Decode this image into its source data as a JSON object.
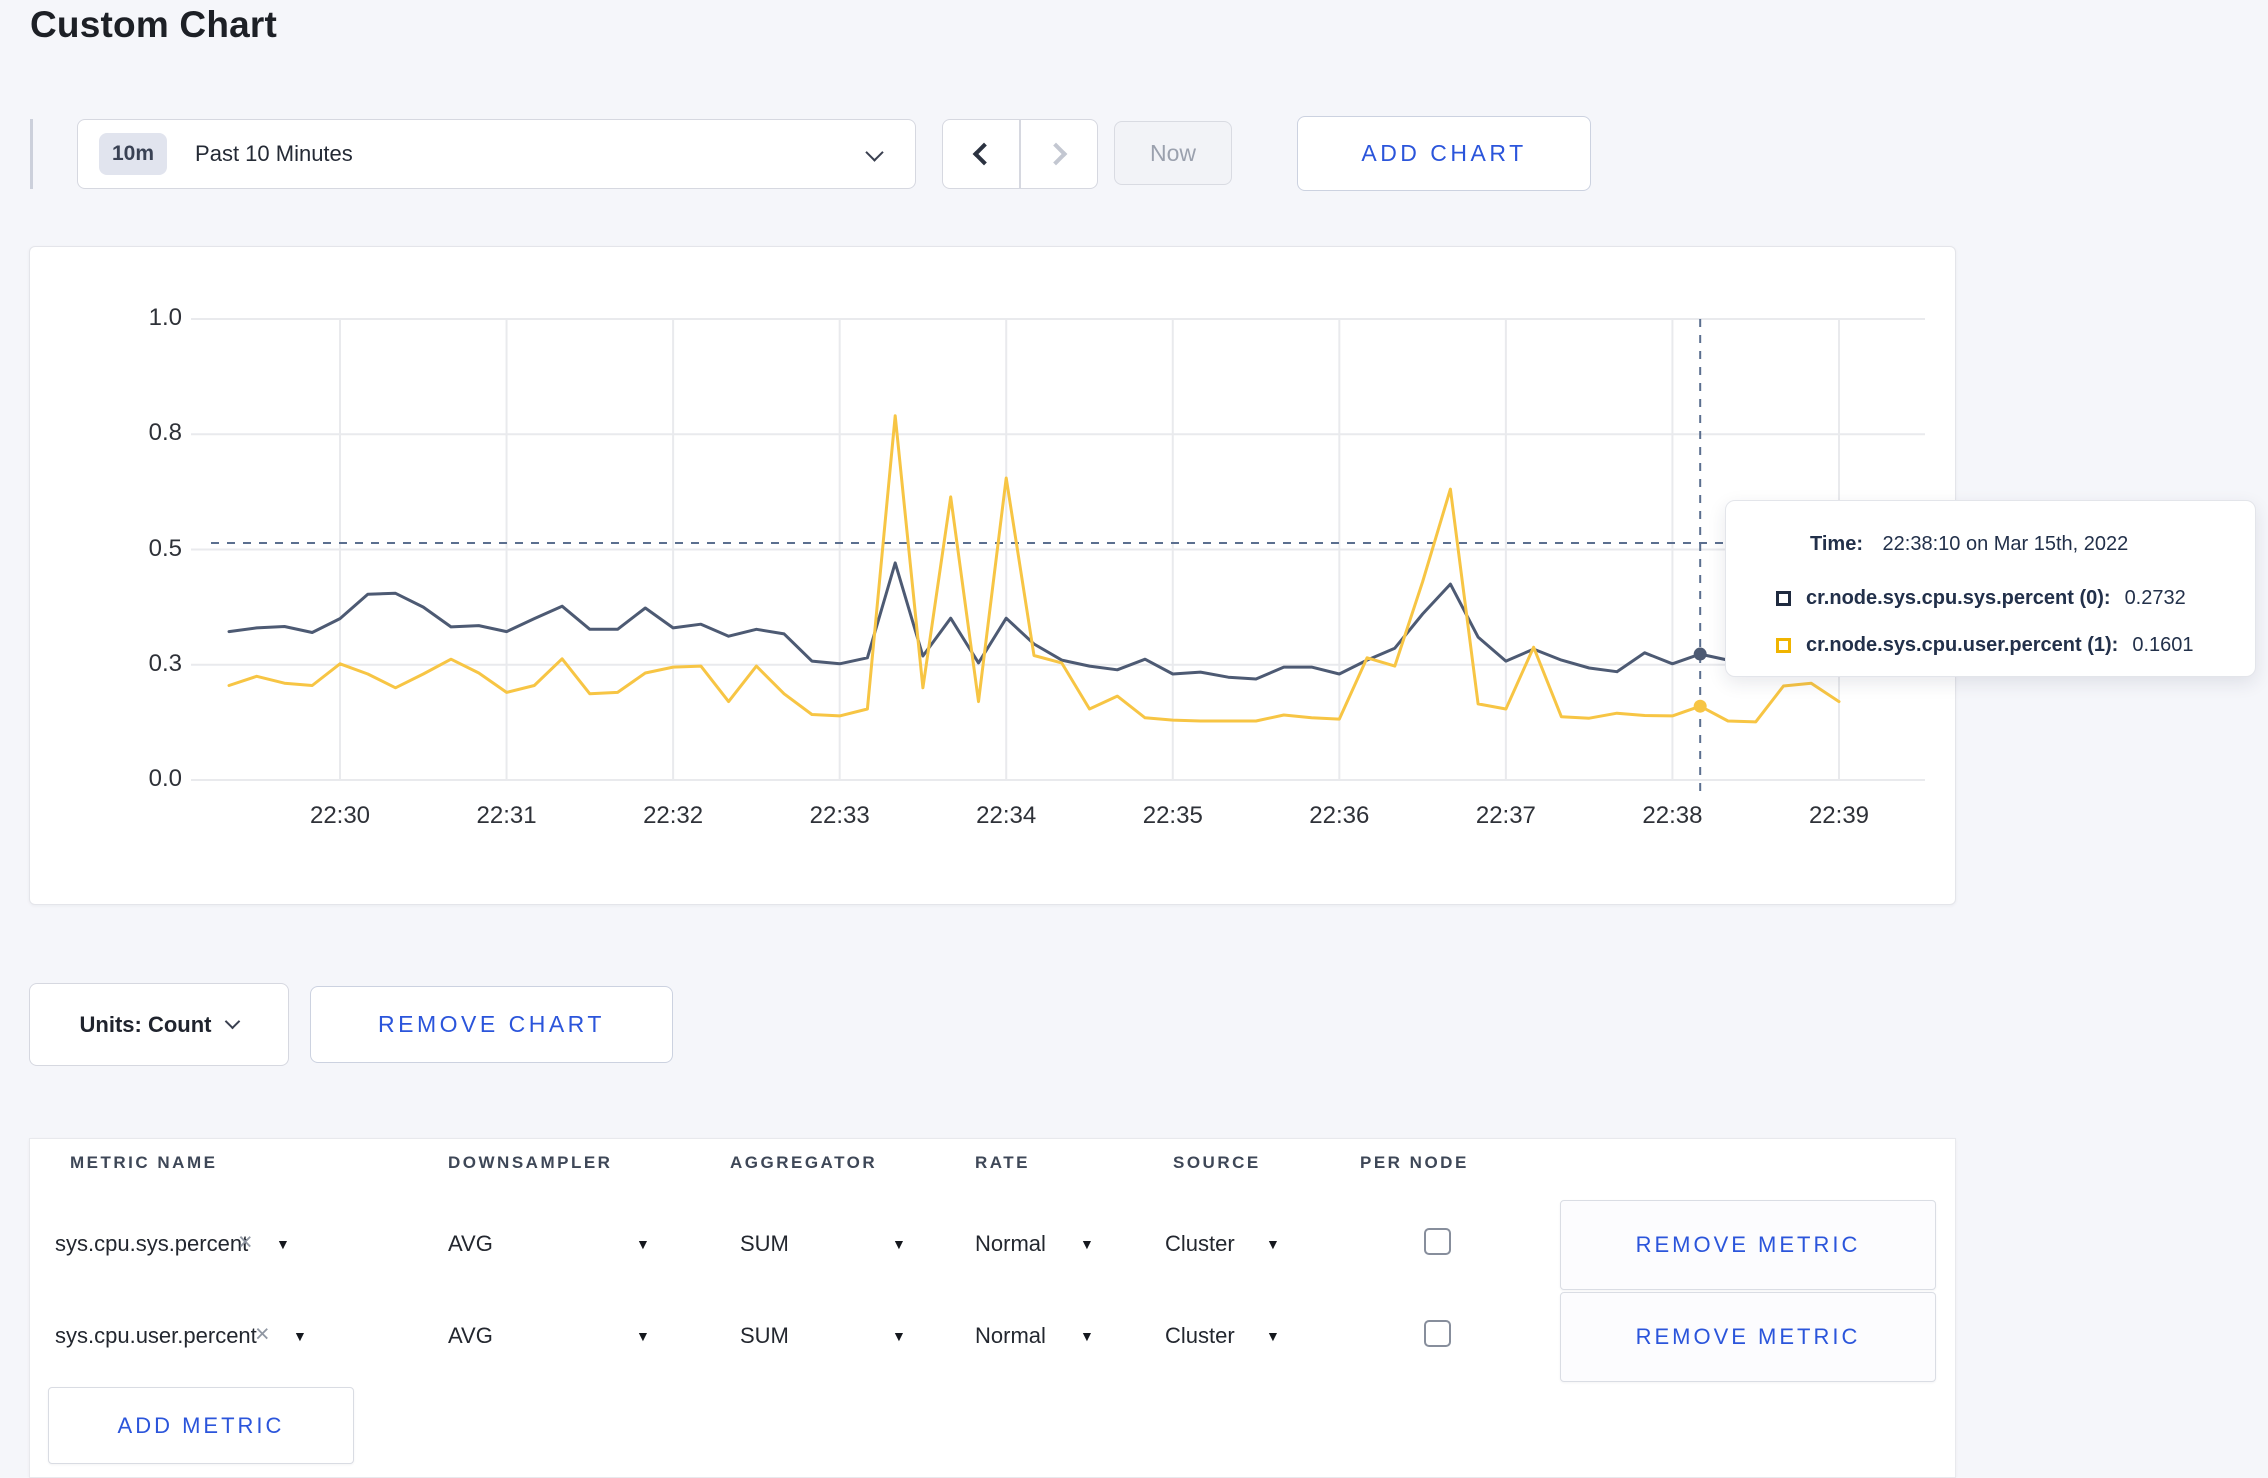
{
  "page": {
    "title": "Custom Chart"
  },
  "toolbar": {
    "range_badge": "10m",
    "range_label": "Past 10 Minutes",
    "prev_label": "previous time window",
    "next_label": "next time window",
    "now_label": "Now",
    "add_chart_label": "ADD CHART"
  },
  "chart_controls": {
    "units_label": "Units: Count",
    "remove_chart_label": "REMOVE CHART"
  },
  "tooltip": {
    "time_label": "Time:",
    "time_value": "22:38:10 on Mar 15th, 2022",
    "series": [
      {
        "name": "cr.node.sys.cpu.sys.percent (0):",
        "value": "0.2732",
        "swatch_color": "#1f2a3f"
      },
      {
        "name": "cr.node.sys.cpu.user.percent (1):",
        "value": "0.1601",
        "swatch_color": "#f0b400"
      }
    ]
  },
  "chart_data": {
    "type": "line",
    "title": "",
    "xlabel": "",
    "ylabel": "",
    "grid": true,
    "x_axis": {
      "tick_labels": [
        "22:30",
        "22:31",
        "22:32",
        "22:33",
        "22:34",
        "22:35",
        "22:36",
        "22:37",
        "22:38",
        "22:39"
      ],
      "tick_sec": [
        0,
        60,
        120,
        180,
        240,
        300,
        360,
        420,
        480,
        540
      ],
      "start_sec": -40,
      "step_sec": 10
    },
    "y_axis": {
      "range": [
        0,
        1
      ],
      "tick_values": [
        0,
        0.25,
        0.5,
        0.75,
        1.0
      ],
      "tick_labels": [
        "0.0",
        "0.3",
        "0.5",
        "0.8",
        "1.0"
      ]
    },
    "series": [
      {
        "name": "cr.node.sys.cpu.sys.percent (0)",
        "color": "#4d5a73",
        "values": [
          0.322,
          0.33,
          0.333,
          0.32,
          0.35,
          0.403,
          0.405,
          0.375,
          0.332,
          0.335,
          0.322,
          0.35,
          0.377,
          0.327,
          0.327,
          0.373,
          0.33,
          0.338,
          0.312,
          0.327,
          0.317,
          0.258,
          0.252,
          0.265,
          0.471,
          0.269,
          0.351,
          0.254,
          0.351,
          0.295,
          0.26,
          0.247,
          0.239,
          0.262,
          0.23,
          0.234,
          0.223,
          0.219,
          0.245,
          0.245,
          0.23,
          0.26,
          0.286,
          0.36,
          0.425,
          0.31,
          0.258,
          0.284,
          0.26,
          0.243,
          0.235,
          0.276,
          0.252,
          0.2732,
          0.26,
          0.255,
          0.26,
          0.25,
          0.255
        ]
      },
      {
        "name": "cr.node.sys.cpu.user.percent (1)",
        "color": "#f7c544",
        "values": [
          0.205,
          0.225,
          0.21,
          0.205,
          0.252,
          0.23,
          0.2,
          0.23,
          0.262,
          0.232,
          0.19,
          0.205,
          0.263,
          0.187,
          0.19,
          0.232,
          0.245,
          0.247,
          0.17,
          0.247,
          0.187,
          0.142,
          0.139,
          0.154,
          0.79,
          0.2,
          0.614,
          0.17,
          0.655,
          0.27,
          0.254,
          0.154,
          0.182,
          0.135,
          0.13,
          0.128,
          0.128,
          0.128,
          0.141,
          0.135,
          0.132,
          0.265,
          0.247,
          0.43,
          0.631,
          0.165,
          0.154,
          0.288,
          0.137,
          0.134,
          0.145,
          0.14,
          0.139,
          0.1601,
          0.128,
          0.126,
          0.204,
          0.21,
          0.17
        ]
      }
    ],
    "crosshair": {
      "x_sec": 490,
      "y_value": 0.514,
      "point_values": [
        0.2732,
        0.1601
      ]
    },
    "colors": {
      "gridline": "#e9eaed",
      "crosshair": "#5b6f8f"
    }
  },
  "metrics_table": {
    "headers": [
      "METRIC NAME",
      "DOWNSAMPLER",
      "AGGREGATOR",
      "RATE",
      "SOURCE",
      "PER NODE"
    ],
    "rows": [
      {
        "metric": "sys.cpu.sys.percent",
        "clear_icon": "×",
        "caret": "▼",
        "downsampler": "AVG",
        "aggregator": "SUM",
        "rate": "Normal",
        "source": "Cluster",
        "per_node_checked": false,
        "remove_label": "REMOVE METRIC"
      },
      {
        "metric": "sys.cpu.user.percent",
        "clear_icon": "×",
        "caret": "▼",
        "downsampler": "AVG",
        "aggregator": "SUM",
        "rate": "Normal",
        "source": "Cluster",
        "per_node_checked": false,
        "remove_label": "REMOVE METRIC"
      }
    ],
    "add_metric_label": "ADD METRIC"
  }
}
